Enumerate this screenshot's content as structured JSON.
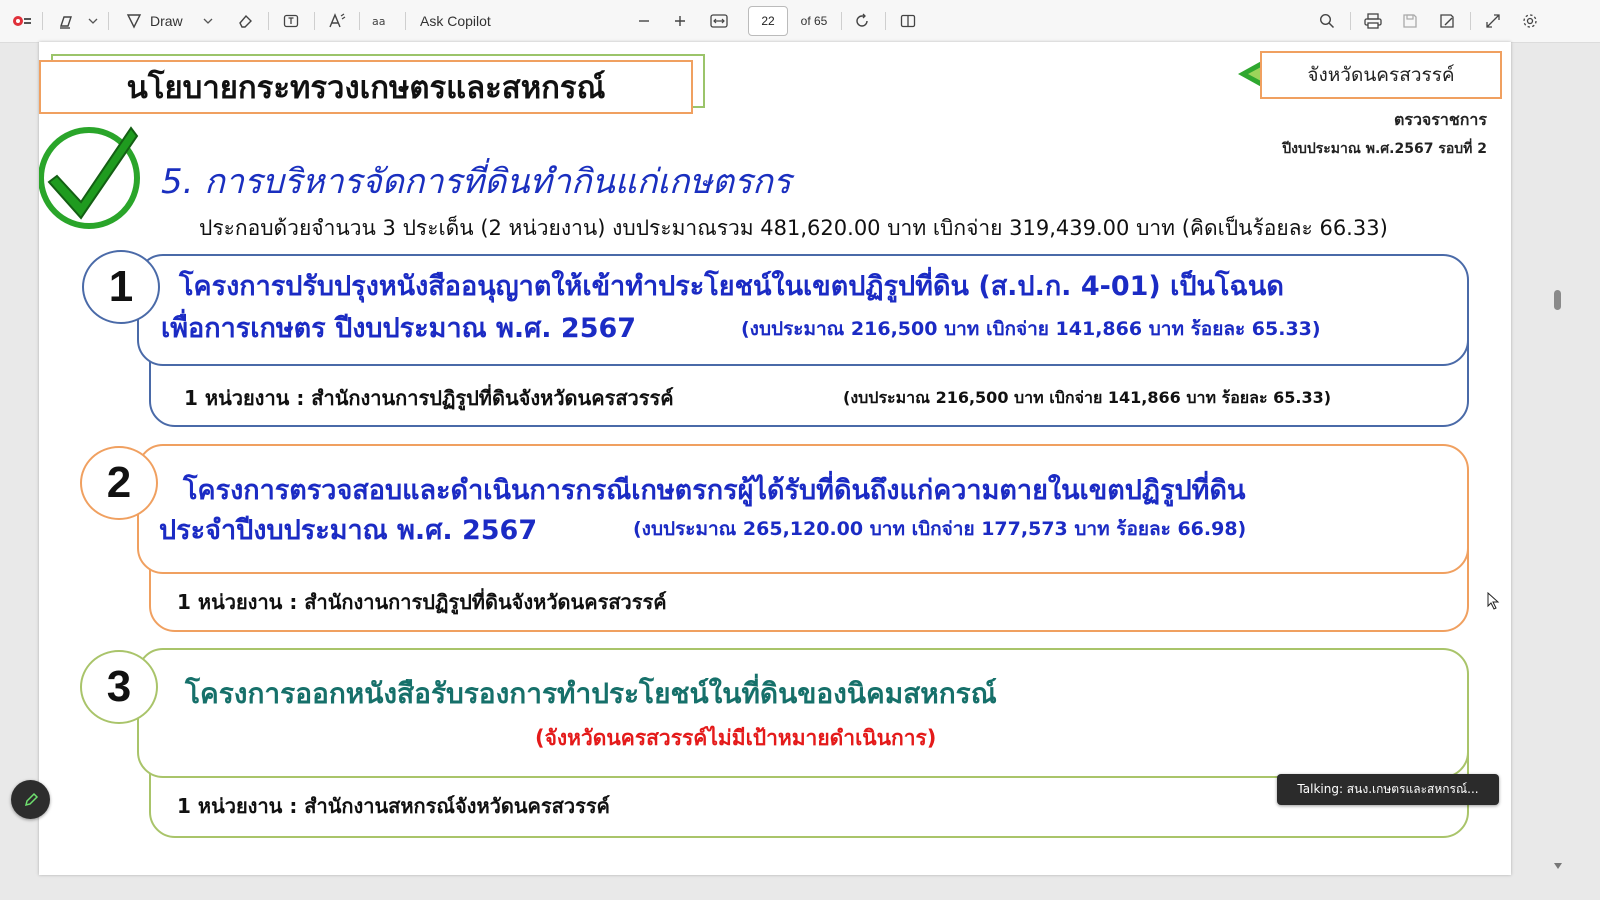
{
  "toolbar": {
    "draw_label": "Draw",
    "ask_copilot_label": "Ask Copilot",
    "page_number": "22",
    "page_total": "of 65"
  },
  "slide": {
    "policy_title": "นโยบายกระทรวงเกษตรและสหกรณ์",
    "province": "จังหวัดนครสวรรค์",
    "inspection": "ตรวจราชการ",
    "fiscal_round": "ปีงบประมาณ พ.ศ.2567 รอบที่ 2",
    "heading": "5. การบริหารจัดการที่ดินทำกินแก่เกษตรกร",
    "summary": "ประกอบด้วยจำนวน  3 ประเด็น  (2 หน่วยงาน) งบประมาณรวม 481,620.00 บาท เบิกจ่าย 319,439.00 บาท (คิดเป็นร้อยละ 66.33)",
    "items": [
      {
        "number": "1",
        "title_line1": "โครงการปรับปรุงหนังสืออนุญาตให้เข้าทำประโยชน์ในเขตปฏิรูปที่ดิน (ส.ป.ก. 4-01)  เป็นโฉนด",
        "title_line2": "เพื่อการเกษตร ปีงบประมาณ พ.ศ. 2567",
        "budget": "(งบประมาณ 216,500 บาท เบิกจ่าย 141,866 บาท ร้อยละ  65.33)",
        "agency": "1 หน่วยงาน  : สำนักงานการปฏิรูปที่ดินจังหวัดนครสวรรค์",
        "agency_budget": "(งบประมาณ 216,500 บาท เบิกจ่าย 141,866 บาท ร้อยละ  65.33)"
      },
      {
        "number": "2",
        "title_line1": "โครงการตรวจสอบและดำเนินการกรณีเกษตรกรผู้ได้รับที่ดินถึงแก่ความตายในเขตปฏิรูปที่ดิน",
        "title_line2": "ประจำปีงบประมาณ พ.ศ. 2567",
        "budget": "(งบประมาณ 265,120.00 บาท เบิกจ่าย 177,573 บาท ร้อยละ  66.98)",
        "agency": "1 หน่วยงาน : สำนักงานการปฏิรูปที่ดินจังหวัดนครสวรรค์"
      },
      {
        "number": "3",
        "title_line1": "โครงการออกหนังสือรับรองการทำประโยชน์ในที่ดินของนิคมสหกรณ์",
        "note": "(จังหวัดนครสวรรค์ไม่มีเป้าหมายดำเนินการ)",
        "agency": "1 หน่วยงาน  : สำนักงานสหกรณ์จังหวัดนครสวรรค์"
      }
    ]
  },
  "toast": "Talking: สนง.เกษตรและสหกรณ์...",
  "colors": {
    "blue_item": "#4a6aa8",
    "orange_item": "#f0a060",
    "green_item": "#a9c46a",
    "title_blue": "#1a2fbf",
    "title_teal": "#16706a",
    "note_red": "#e41a1a"
  }
}
